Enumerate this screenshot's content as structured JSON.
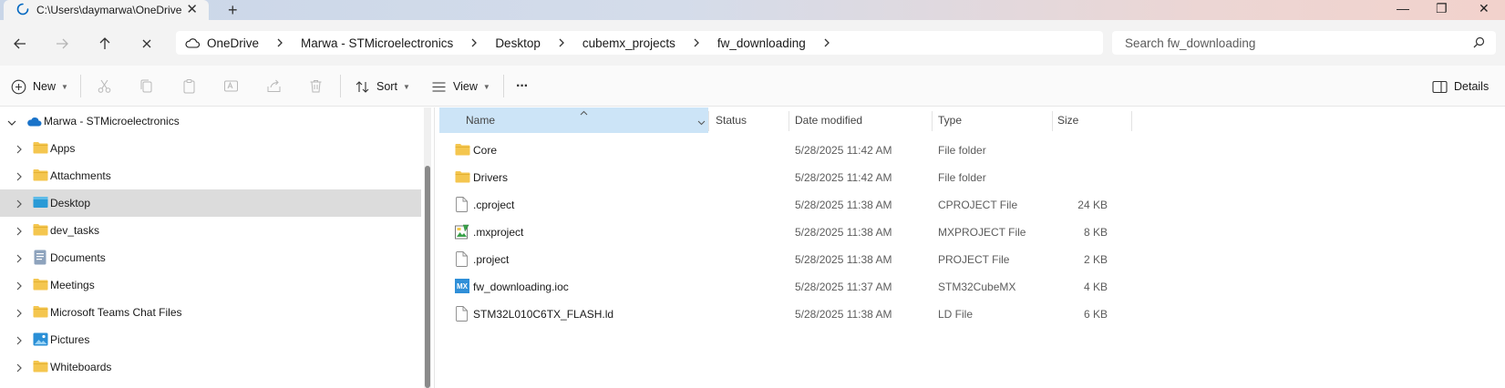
{
  "window": {
    "tab_title": "C:\\Users\\daymarwa\\OneDrive",
    "tab_close": "✕",
    "new_tab": "+",
    "minimize": "—",
    "restore": "❐",
    "close": "✕"
  },
  "address": {
    "crumbs": [
      "OneDrive",
      "Marwa - STMicroelectronics",
      "Desktop",
      "cubemx_projects",
      "fw_downloading"
    ]
  },
  "search": {
    "placeholder": "Search fw_downloading"
  },
  "toolbar": {
    "new_label": "New",
    "sort_label": "Sort",
    "view_label": "View",
    "more_label": "···",
    "details_label": "Details"
  },
  "nav": {
    "root": "Marwa - STMicroelectronics",
    "items": [
      {
        "label": "Apps",
        "icon": "folder-icon"
      },
      {
        "label": "Attachments",
        "icon": "folder-icon"
      },
      {
        "label": "Desktop",
        "icon": "desktop-icon",
        "selected": true
      },
      {
        "label": "dev_tasks",
        "icon": "folder-icon"
      },
      {
        "label": "Documents",
        "icon": "documents-icon"
      },
      {
        "label": "Meetings",
        "icon": "folder-icon"
      },
      {
        "label": "Microsoft Teams Chat Files",
        "icon": "folder-icon"
      },
      {
        "label": "Pictures",
        "icon": "pictures-icon"
      },
      {
        "label": "Whiteboards",
        "icon": "folder-icon"
      }
    ]
  },
  "columns": {
    "name": "Name",
    "status": "Status",
    "date": "Date modified",
    "type": "Type",
    "size": "Size"
  },
  "files": [
    {
      "name": "Core",
      "date": "5/28/2025 11:42 AM",
      "type": "File folder",
      "size": "",
      "icon": "folder-icon"
    },
    {
      "name": "Drivers",
      "date": "5/28/2025 11:42 AM",
      "type": "File folder",
      "size": "",
      "icon": "folder-icon"
    },
    {
      "name": ".cproject",
      "date": "5/28/2025 11:38 AM",
      "type": "CPROJECT File",
      "size": "24 KB",
      "icon": "file-icon"
    },
    {
      "name": ".mxproject",
      "date": "5/28/2025 11:38 AM",
      "type": "MXPROJECT File",
      "size": "8 KB",
      "icon": "mxproject-icon"
    },
    {
      "name": ".project",
      "date": "5/28/2025 11:38 AM",
      "type": "PROJECT File",
      "size": "2 KB",
      "icon": "file-icon"
    },
    {
      "name": "fw_downloading.ioc",
      "date": "5/28/2025 11:37 AM",
      "type": "STM32CubeMX",
      "size": "4 KB",
      "icon": "cubemx-icon",
      "icon_text": "MX"
    },
    {
      "name": "STM32L010C6TX_FLASH.ld",
      "date": "5/28/2025 11:38 AM",
      "type": "LD File",
      "size": "6 KB",
      "icon": "file-icon"
    }
  ],
  "colors": {
    "accent": "#0067c0",
    "folder": "#f4c64f",
    "selected_row": "#dcdcdc",
    "header_highlight": "#cce4f7"
  }
}
